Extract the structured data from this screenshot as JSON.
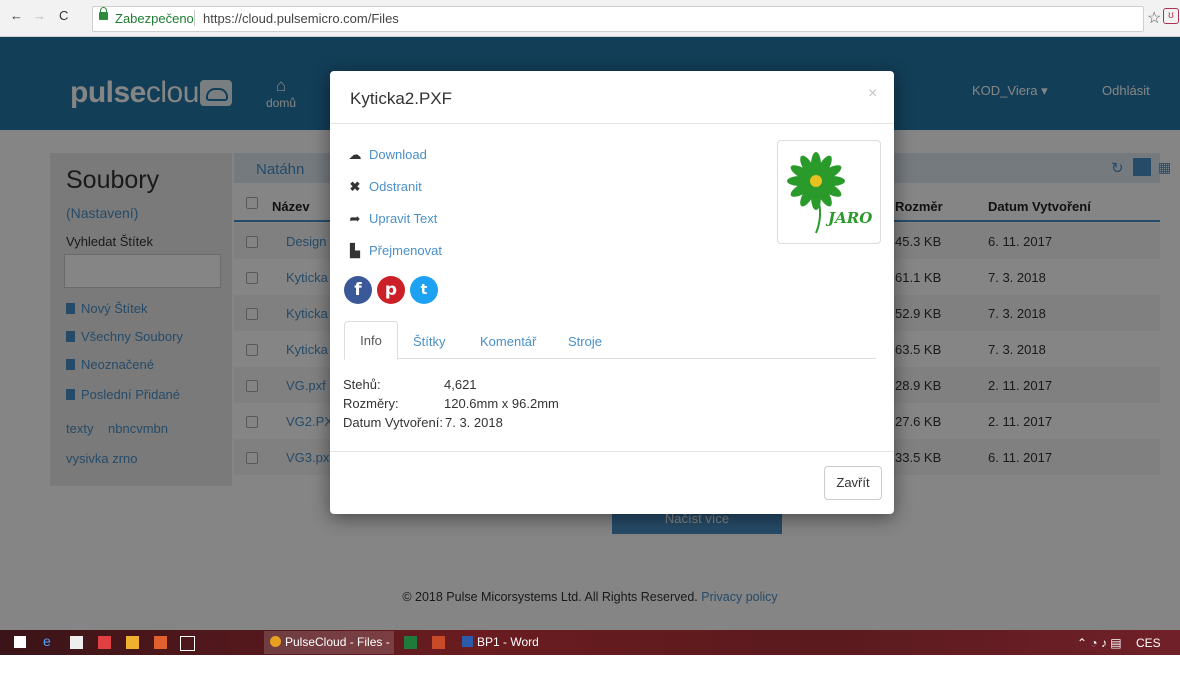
{
  "browser": {
    "secure_label": "Zabezpečeno",
    "url": "https://cloud.pulsemicro.com/Files",
    "back": "←",
    "forward": "→",
    "reload": "C",
    "star": "☆"
  },
  "header": {
    "logo_bold": "pulse",
    "logo_rest": "cloud",
    "home_label": "domů",
    "user_label": "KOD_Viera ▾",
    "logout_label": "Odhlásit"
  },
  "sidebar": {
    "title": "Soubory",
    "settings": "(Nastavení)",
    "search_label": "Vyhledat Štítek",
    "search_value": "",
    "links": [
      "Nový Štítek",
      "Všechny Soubory",
      "Neoznačené",
      "Poslední Přidané"
    ],
    "tags": [
      "texty",
      "nbncvmbn",
      "vysivka zrno"
    ]
  },
  "table": {
    "upload_label": "Natáhn",
    "headers": {
      "name": "Název",
      "size": "Rozměr",
      "date": "Datum Vytvoření"
    },
    "rows": [
      {
        "name": "Design",
        "size": "45.3 KB",
        "date": "6. 11. 2017"
      },
      {
        "name": "Kyticka",
        "size": "61.1 KB",
        "date": "7. 3. 2018"
      },
      {
        "name": "Kyticka",
        "size": "52.9 KB",
        "date": "7. 3. 2018"
      },
      {
        "name": "Kyticka",
        "size": "63.5 KB",
        "date": "7. 3. 2018"
      },
      {
        "name": "VG.pxf",
        "size": "28.9 KB",
        "date": "2. 11. 2017"
      },
      {
        "name": "VG2.PX",
        "size": "27.6 KB",
        "date": "2. 11. 2017"
      },
      {
        "name": "VG3.px",
        "size": "33.5 KB",
        "date": "6. 11. 2017"
      }
    ],
    "load_more": "Načíst více"
  },
  "footer": {
    "copyright": "© 2018 Pulse Micorsystems Ltd. All Rights Reserved.",
    "privacy": "Privacy policy"
  },
  "modal": {
    "title": "Kyticka2.PXF",
    "close_x": "×",
    "actions": {
      "download": "Download",
      "delete": "Odstranit",
      "edit_text": "Upravit Text",
      "rename": "Přejmenovat"
    },
    "thumbnail_text": "JARO",
    "tabs": [
      "Info",
      "Štítky",
      "Komentář",
      "Stroje"
    ],
    "info": {
      "stitches_label": "Stehů:",
      "stitches_value": "4,621",
      "dims_label": "Rozměry:",
      "dims_value": "120.6mm x 96.2mm",
      "date_label": "Datum Vytvoření:",
      "date_value": "7. 3. 2018"
    },
    "close_button": "Zavřít"
  },
  "taskbar": {
    "items": [
      "PulseCloud - Files - G...",
      "BP1 - Word"
    ],
    "lang": "CES"
  },
  "colors": {
    "accent": "#4a90c8",
    "header": "#2478a8",
    "facebook": "#3b5998",
    "pinterest": "#cb2027",
    "twitter": "#1da1f2"
  }
}
